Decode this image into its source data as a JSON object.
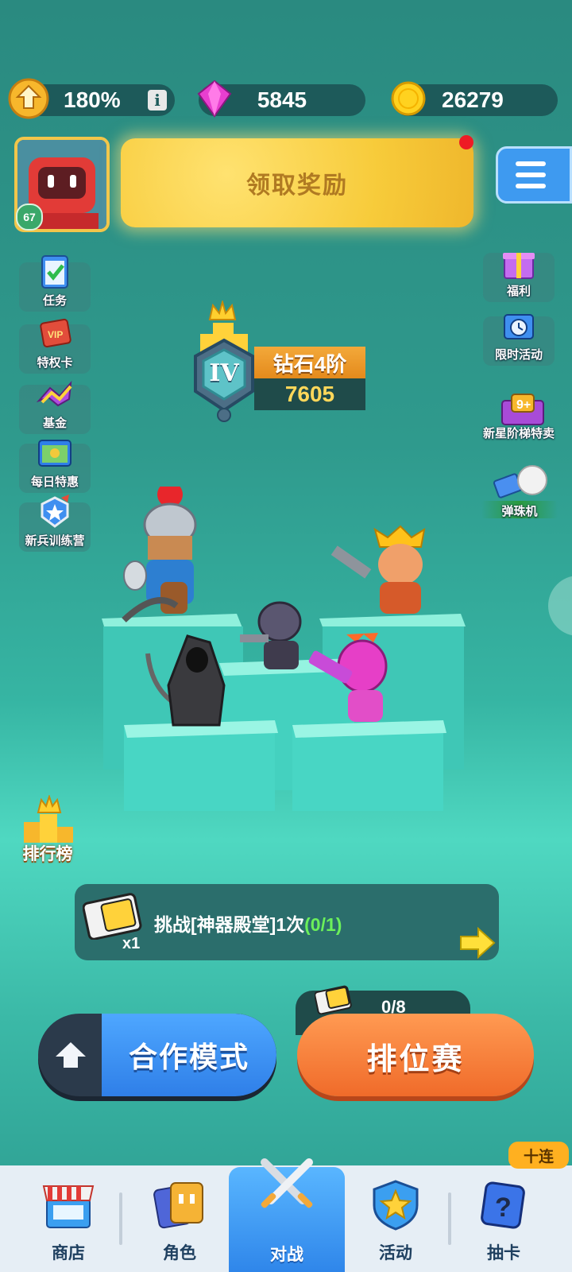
{
  "resources": {
    "ratio": "180%",
    "gems": "5845",
    "coins": "26279"
  },
  "player": {
    "level": "67"
  },
  "claim_reward_label": "领取奖励",
  "left_menu": [
    {
      "label": "任务",
      "icon": "task-clipboard-icon"
    },
    {
      "label": "特权卡",
      "icon": "vip-card-icon"
    },
    {
      "label": "基金",
      "icon": "fund-icon"
    },
    {
      "label": "每日特惠",
      "icon": "daily-deal-icon"
    },
    {
      "label": "新兵训练营",
      "icon": "recruit-camp-icon"
    }
  ],
  "right_menu": [
    {
      "label": "福利",
      "icon": "gift-box-icon"
    },
    {
      "label": "限时活动",
      "icon": "limited-event-icon"
    },
    {
      "label": "新星阶梯特卖",
      "icon": "ladder-sale-icon"
    },
    {
      "label": "弹珠机",
      "icon": "pinball-icon"
    }
  ],
  "rank": {
    "tier_symbol": "IV",
    "name": "钻石4阶",
    "points": "7605"
  },
  "leaderboard_label": "排行榜",
  "challenge": {
    "ticket_count": "x1",
    "text": "挑战[神器殿堂]1次",
    "progress": "(0/1)"
  },
  "ranked_counter": "0/8",
  "buttons": {
    "coop": "合作模式",
    "ranked": "排位赛"
  },
  "ten_pull_badge": "十连",
  "nav": [
    {
      "label": "商店",
      "icon": "shop-icon"
    },
    {
      "label": "角色",
      "icon": "character-cards-icon"
    },
    {
      "label": "对战",
      "icon": "crossed-swords-icon"
    },
    {
      "label": "活动",
      "icon": "star-shield-icon"
    },
    {
      "label": "抽卡",
      "icon": "mystery-card-icon"
    }
  ],
  "colors": {
    "accent_blue": "#3e9af0",
    "accent_orange": "#f06b2a",
    "progress_green": "#6bf05a",
    "gold": "#f7cb3a"
  }
}
